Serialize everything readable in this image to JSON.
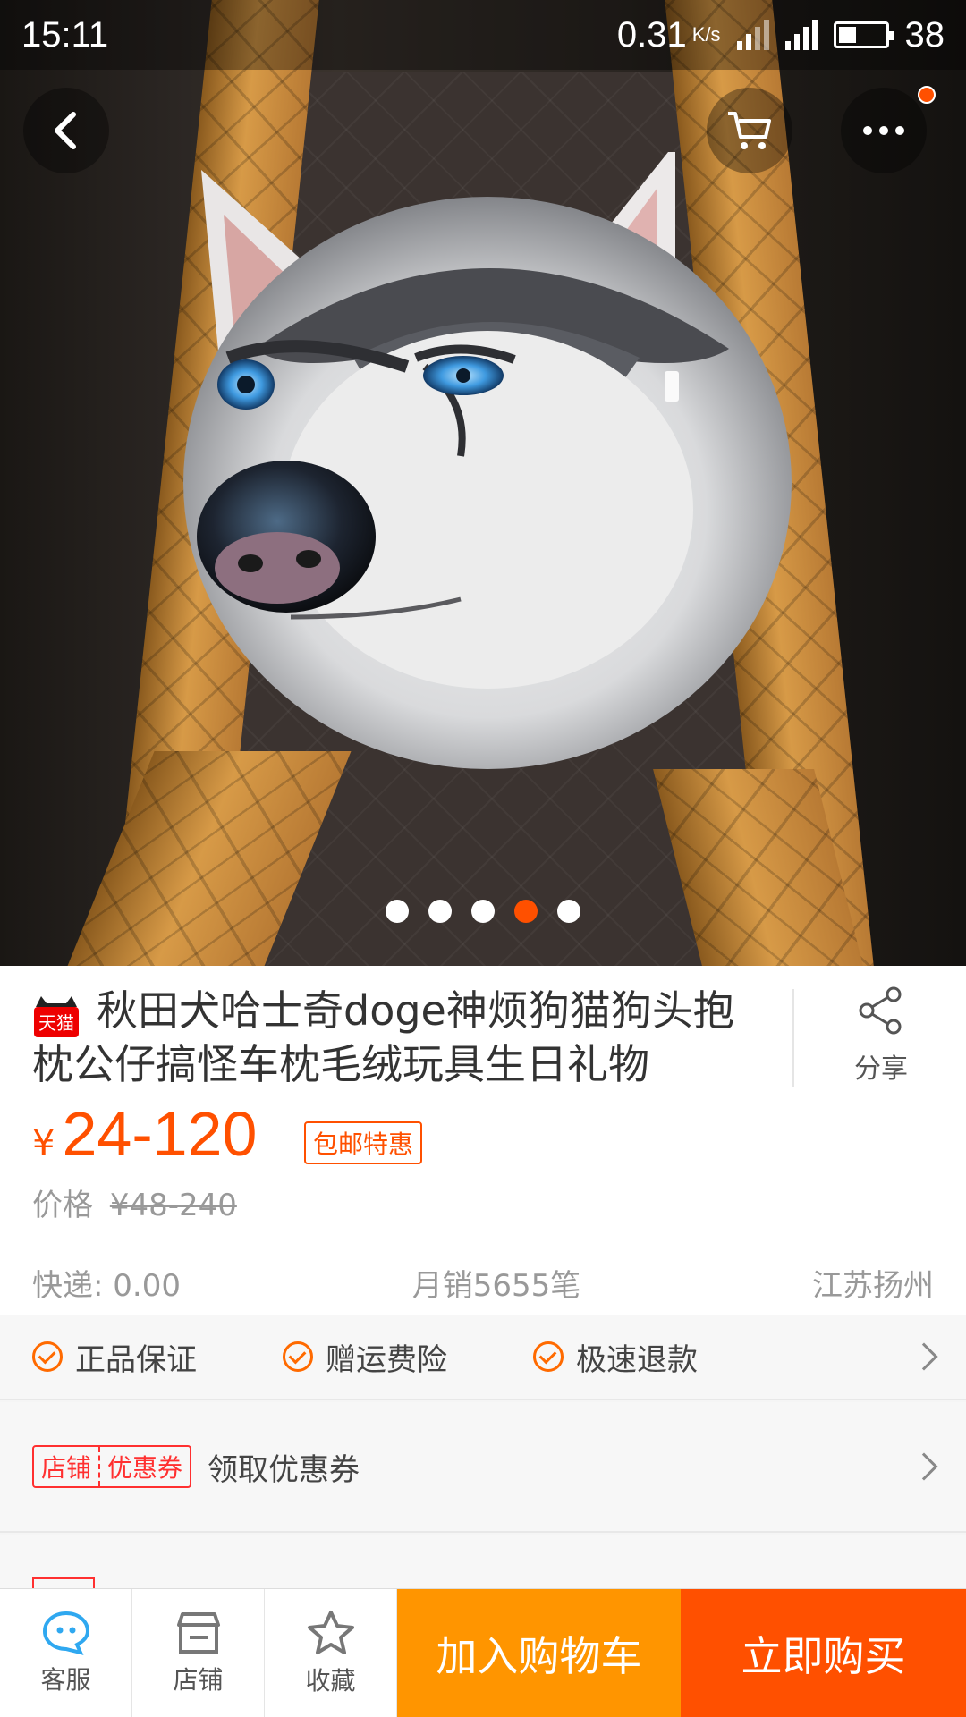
{
  "status_bar": {
    "time": "15:11",
    "network_speed": "0.31",
    "speed_unit": "K/s",
    "battery": "38",
    "battery_level": 0.38
  },
  "gallery": {
    "image_count": 5,
    "active_index": 3
  },
  "product": {
    "store_badge": "天猫",
    "title": "秋田犬哈士奇doge神烦狗猫狗头抱枕公仔搞怪车枕毛绒玩具生日礼物",
    "share_label": "分享",
    "currency": "¥",
    "price": "24-120",
    "promo_tag": "包邮特惠",
    "original_price_label": "价格",
    "original_price": "¥48-240",
    "shipping": "快递: 0.00",
    "monthly_sales": "月销5655笔",
    "location": "江苏扬州"
  },
  "guarantees": [
    {
      "label": "正品保证"
    },
    {
      "label": "赠运费险"
    },
    {
      "label": "极速退款"
    }
  ],
  "coupon": {
    "tag_left": "店铺",
    "tag_right": "优惠券",
    "text": "领取优惠券"
  },
  "bottom_bar": {
    "service_label": "客服",
    "store_label": "店铺",
    "favorite_label": "收藏",
    "add_to_cart": "加入购物车",
    "buy_now": "立即购买"
  },
  "colors": {
    "accent": "#ff5000",
    "cart_button": "#ff9500"
  }
}
